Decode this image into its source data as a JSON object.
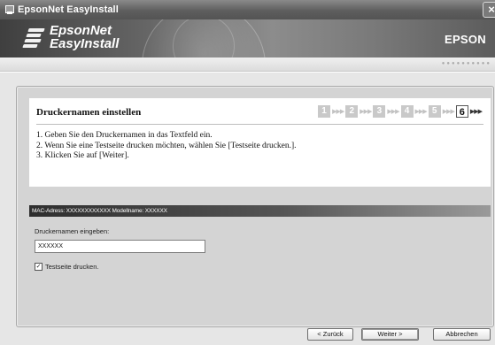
{
  "window": {
    "title": "EpsonNet EasyInstall",
    "close_glyph": "×"
  },
  "banner": {
    "product_name": "EpsonNet\nEasyInstall",
    "brand": "EPSON"
  },
  "step": {
    "title": "Druckernamen einstellen",
    "current": 6,
    "steps": [
      "1",
      "2",
      "3",
      "4",
      "5",
      "6"
    ],
    "instructions": [
      "1. Geben Sie den Druckernamen in das Textfeld ein.",
      "2. Wenn Sie eine Testseite drucken möchten, wählen Sie [Testseite drucken.].",
      "3. Klicken Sie auf [Weiter]."
    ]
  },
  "info_bar": {
    "text": "MAC-Adress: XXXXXXXXXXXX Modellname: XXXXXX"
  },
  "form": {
    "name_label": "Druckernamen eingeben:",
    "name_value": "XXXXXX",
    "test_page_checked": true,
    "test_page_label": "Testseite drucken."
  },
  "buttons": {
    "back": "< Zurück",
    "next": "Weiter >",
    "cancel": "Abbrechen"
  },
  "colors": {
    "title_bar": "#5e5e5e",
    "banner": "#666666",
    "panel": "#d4d4d4"
  },
  "icons": [
    "app-icon",
    "close-icon",
    "epson-logo-icon",
    "check-icon"
  ]
}
